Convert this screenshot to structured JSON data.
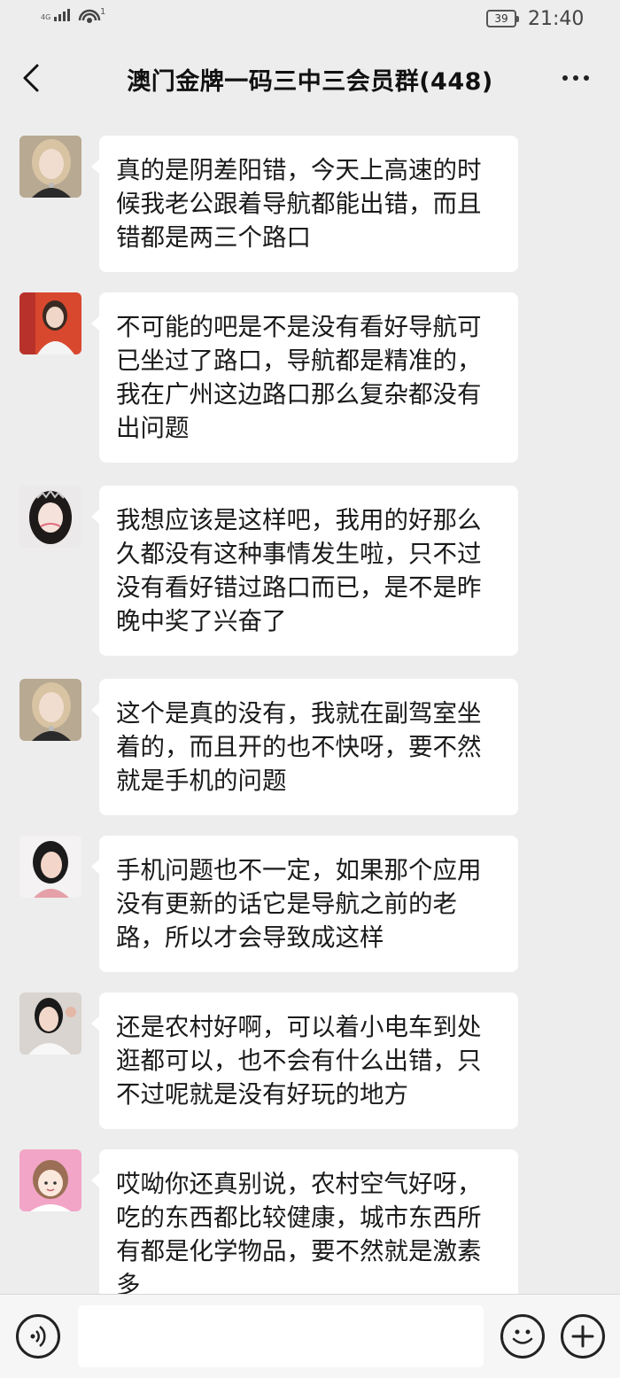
{
  "status_bar": {
    "network": "4G",
    "wifi_badge": "1",
    "battery": "39",
    "time": "21:40"
  },
  "header": {
    "title": "澳门金牌一码三中三会员群(448)"
  },
  "messages": [
    {
      "avatar": "avatar-photo-woman-1",
      "text": "真的是阴差阳错，今天上高速的时候我老公跟着导航都能出错，而且错都是两三个路口"
    },
    {
      "avatar": "avatar-photo-woman-2",
      "text": "不可能的吧是不是没有看好导航可已坐过了路口，导航都是精准的，我在广州这边路口那么复杂都没有出问题"
    },
    {
      "avatar": "avatar-photo-woman-3",
      "text": "我想应该是这样吧，我用的好那么久都没有这种事情发生啦，只不过没有看好错过路口而已，是不是昨晚中奖了兴奋了"
    },
    {
      "avatar": "avatar-photo-woman-1",
      "text": "这个是真的没有，我就在副驾室坐着的，而且开的也不快呀，要不然就是手机的问题"
    },
    {
      "avatar": "avatar-photo-woman-4",
      "text": "手机问题也不一定，如果那个应用没有更新的话它是导航之前的老路，所以才会导致成这样"
    },
    {
      "avatar": "avatar-photo-woman-5",
      "text": "还是农村好啊，可以着小电车到处逛都可以，也不会有什么出错，只不过呢就是没有好玩的地方"
    },
    {
      "avatar": "avatar-cartoon-girl",
      "text": "哎呦你还真别说，农村空气好呀，吃的东西都比较健康，城市东西所有都是化学物品，要不然就是激素多"
    }
  ],
  "input_bar": {
    "placeholder": ""
  }
}
